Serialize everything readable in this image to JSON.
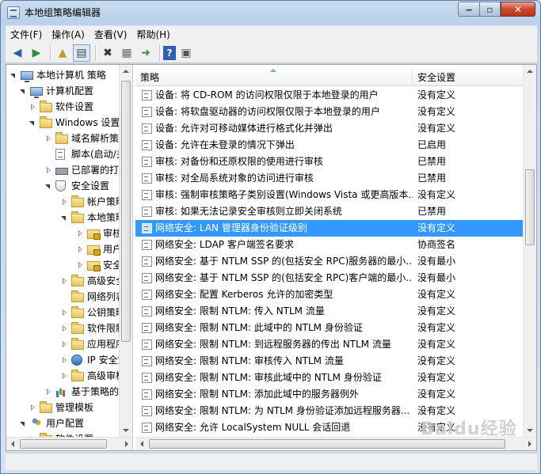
{
  "window": {
    "title": "本地组策略编辑器"
  },
  "menu": [
    {
      "name": "menu-file",
      "label": "文件(F)"
    },
    {
      "name": "menu-action",
      "label": "操作(A)"
    },
    {
      "name": "menu-view",
      "label": "查看(V)"
    },
    {
      "name": "menu-help",
      "label": "帮助(H)"
    }
  ],
  "tree": {
    "items": [
      {
        "label": "本地计算机 策略",
        "icon": "computer-icon"
      },
      {
        "label": "计算机配置",
        "icon": "computer-icon"
      },
      {
        "label": "软件设置",
        "icon": "folder-icon"
      },
      {
        "label": "Windows 设置",
        "icon": "folder-icon"
      },
      {
        "label": "域名解析策略",
        "icon": "folder-icon"
      },
      {
        "label": "脚本(启动/关机)",
        "icon": "document-icon"
      },
      {
        "label": "已部署的打印机",
        "icon": "printer-icon"
      },
      {
        "label": "安全设置",
        "icon": "shield-icon"
      },
      {
        "label": "帐户策略",
        "icon": "folder-icon"
      },
      {
        "label": "本地策略",
        "icon": "folder-icon"
      },
      {
        "label": "审核策略",
        "icon": "lock-folder-icon"
      },
      {
        "label": "用户权限分配",
        "icon": "lock-folder-icon"
      },
      {
        "label": "安全选项",
        "icon": "lock-folder-icon"
      },
      {
        "label": "高级安全 Windows 防火墙",
        "icon": "folder-icon"
      },
      {
        "label": "网络列表管理器策略",
        "icon": "folder-icon"
      },
      {
        "label": "公钥策略",
        "icon": "folder-icon"
      },
      {
        "label": "软件限制策略",
        "icon": "folder-icon"
      },
      {
        "label": "应用程序控制策略",
        "icon": "folder-icon"
      },
      {
        "label": "IP 安全策略",
        "icon": "network-icon"
      },
      {
        "label": "高级审核策略配置",
        "icon": "folder-icon"
      },
      {
        "label": "基于策略的 QoS",
        "icon": "chart-icon"
      },
      {
        "label": "管理模板",
        "icon": "folder-icon"
      },
      {
        "label": "用户配置",
        "icon": "users-icon"
      },
      {
        "label": "软件设置",
        "icon": "folder-icon"
      }
    ]
  },
  "list": {
    "header_policy": "策略",
    "header_setting": "安全设置",
    "rows": [
      {
        "policy": "设备: 将 CD-ROM 的访问权限仅限于本地登录的用户",
        "setting": "没有定义"
      },
      {
        "policy": "设备: 将软盘驱动器的访问权限仅限于本地登录的用户",
        "setting": "没有定义"
      },
      {
        "policy": "设备: 允许对可移动媒体进行格式化并弹出",
        "setting": "没有定义"
      },
      {
        "policy": "设备: 允许在未登录的情况下弹出",
        "setting": "已启用"
      },
      {
        "policy": "审核: 对备份和还原权限的使用进行审核",
        "setting": "已禁用"
      },
      {
        "policy": "审核: 对全局系统对象的访问进行审核",
        "setting": "已禁用"
      },
      {
        "policy": "审核: 强制审核策略子类别设置(Windows Vista 或更高版本...",
        "setting": "没有定义"
      },
      {
        "policy": "审核: 如果无法记录安全审核则立即关闭系统",
        "setting": "已禁用"
      },
      {
        "policy": "网络安全: LAN 管理器身份验证级别",
        "setting": "没有定义"
      },
      {
        "policy": "网络安全: LDAP 客户端签名要求",
        "setting": "协商签名"
      },
      {
        "policy": "网络安全: 基于 NTLM SSP 的(包括安全 RPC)服务器的最小...",
        "setting": "没有最小"
      },
      {
        "policy": "网络安全: 基于 NTLM SSP 的(包括安全 RPC)客户端的最小...",
        "setting": "没有最小"
      },
      {
        "policy": "网络安全: 配置 Kerberos 允许的加密类型",
        "setting": "没有定义"
      },
      {
        "policy": "网络安全: 限制 NTLM: 传入 NTLM 流量",
        "setting": "没有定义"
      },
      {
        "policy": "网络安全: 限制 NTLM: 此域中的 NTLM 身份验证",
        "setting": "没有定义"
      },
      {
        "policy": "网络安全: 限制 NTLM: 到远程服务器的传出 NTLM 流量",
        "setting": "没有定义"
      },
      {
        "policy": "网络安全: 限制 NTLM: 审核传入 NTLM 流量",
        "setting": "没有定义"
      },
      {
        "policy": "网络安全: 限制 NTLM: 审核此域中的 NTLM 身份验证",
        "setting": "没有定义"
      },
      {
        "policy": "网络安全: 限制 NTLM: 添加此域中的服务器例外",
        "setting": "没有定义"
      },
      {
        "policy": "网络安全: 限制 NTLM: 为 NTLM 身份验证添加远程服务器...",
        "setting": "没有定义"
      },
      {
        "policy": "网络安全: 允许 LocalSystem NULL 会话回退",
        "setting": "没有定义"
      }
    ],
    "selected_index": 8
  },
  "watermark": "Baidu经验",
  "colors": {
    "selection": "#3399ff"
  }
}
